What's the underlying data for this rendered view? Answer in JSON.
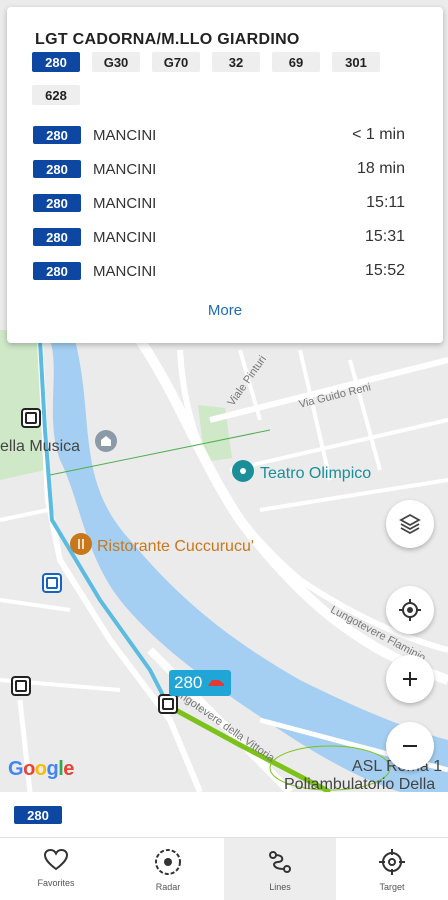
{
  "stop": {
    "title": "LGT CADORNA/M.LLO GIARDINO",
    "lines": [
      "280",
      "G30",
      "G70",
      "32",
      "69",
      "301",
      "628"
    ],
    "active_line": "280"
  },
  "arrivals": [
    {
      "line": "280",
      "destination": "MANCINI",
      "time": "< 1 min"
    },
    {
      "line": "280",
      "destination": "MANCINI",
      "time": "18 min"
    },
    {
      "line": "280",
      "destination": "MANCINI",
      "time": "15:11"
    },
    {
      "line": "280",
      "destination": "MANCINI",
      "time": "15:31"
    },
    {
      "line": "280",
      "destination": "MANCINI",
      "time": "15:52"
    }
  ],
  "more_label": "More",
  "map": {
    "labels": {
      "musica": "ella Musica",
      "teatro": "Teatro Olimpico",
      "ristorante": "Ristorante Cuccurucu'",
      "asl": "ASL Roma 1",
      "poliambulatorio": "Poliambulatorio Della",
      "via_guido_reni": "Via Guido Reni",
      "viale_pinturicchio": "Viale Pinturi",
      "lungotevere_flaminio": "Lungotevere Flaminio",
      "lungotevere_vittoria": "Lungotevere della Vittoria"
    },
    "bus_marker_line": "280",
    "google": [
      "G",
      "o",
      "o",
      "g",
      "l",
      "e"
    ]
  },
  "selected_line": "280",
  "nav": [
    {
      "label": "Favorites",
      "icon": "heart-icon"
    },
    {
      "label": "Radar",
      "icon": "radar-icon"
    },
    {
      "label": "Lines",
      "icon": "route-icon"
    },
    {
      "label": "Target",
      "icon": "target-icon"
    }
  ],
  "colors": {
    "line_badge": "#0d47a1",
    "bus_route": "#5bbbe0",
    "green_route": "#7cc21a",
    "river": "#a4cff2",
    "link": "#1e6bb8"
  }
}
